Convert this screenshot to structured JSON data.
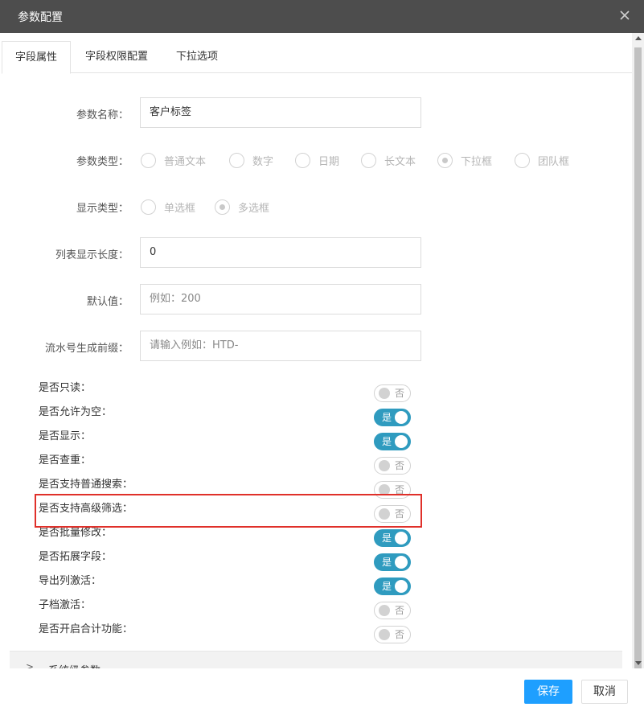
{
  "dialog": {
    "title": "参数配置",
    "tabs": [
      {
        "label": "字段属性",
        "active": true
      },
      {
        "label": "字段权限配置",
        "active": false
      },
      {
        "label": "下拉选项",
        "active": false
      }
    ]
  },
  "form": {
    "param_name": {
      "label": "参数名称：",
      "value": "客户标签"
    },
    "param_type": {
      "label": "参数类型：",
      "options": [
        "普通文本",
        "数字",
        "日期",
        "长文本",
        "下拉框",
        "团队框"
      ],
      "selected": "下拉框"
    },
    "display_type": {
      "label": "显示类型：",
      "options": [
        "单选框",
        "多选框"
      ],
      "selected": "多选框"
    },
    "list_length": {
      "label": "列表显示长度：",
      "value": "0"
    },
    "default_value": {
      "label": "默认值：",
      "placeholder": "例如：200"
    },
    "serial_prefix": {
      "label": "流水号生成前缀：",
      "placeholder": "请输入例如：HTD-"
    }
  },
  "switches": [
    {
      "label": "是否只读：",
      "on": false,
      "text": "否"
    },
    {
      "label": "是否允许为空：",
      "on": true,
      "text": "是"
    },
    {
      "label": "是否显示：",
      "on": true,
      "text": "是"
    },
    {
      "label": "是否查重：",
      "on": false,
      "text": "否"
    },
    {
      "label": "是否支持普通搜索：",
      "on": false,
      "text": "否"
    },
    {
      "label": "是否支持高级筛选：",
      "on": false,
      "text": "否"
    },
    {
      "label": "是否批量修改：",
      "on": true,
      "text": "是"
    },
    {
      "label": "是否拓展字段：",
      "on": true,
      "text": "是"
    },
    {
      "label": "导出列激活：",
      "on": true,
      "text": "是"
    },
    {
      "label": "子档激活：",
      "on": false,
      "text": "否"
    },
    {
      "label": "是否开启合计功能：",
      "on": false,
      "text": "否"
    }
  ],
  "collapse": {
    "label": "系统级参数"
  },
  "footer": {
    "save": "保存",
    "cancel": "取消"
  },
  "colors": {
    "switch_on": "#2f9bbf",
    "primary": "#1e9fff",
    "highlight": "#e0302a",
    "titlebar": "#4d4d4d"
  }
}
